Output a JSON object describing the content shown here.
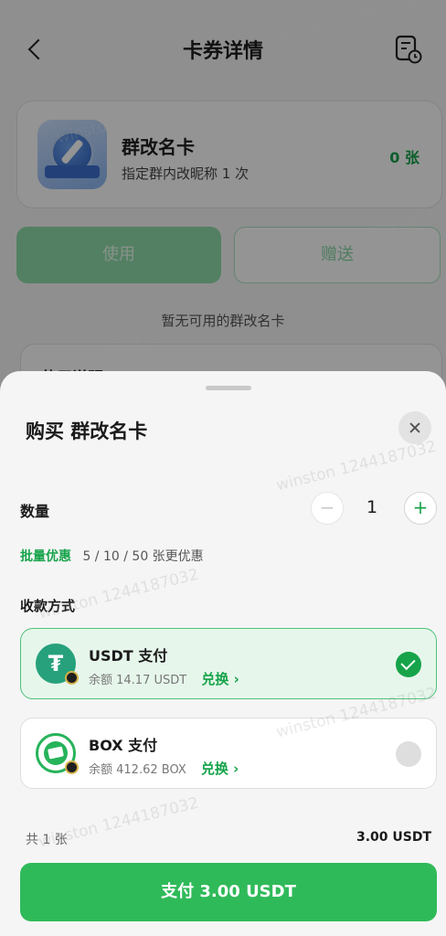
{
  "header": {
    "title": "卡券详情"
  },
  "card": {
    "name": "群改名卡",
    "description": "指定群内改昵称 1 次",
    "count": "0 张"
  },
  "actions": {
    "use_label": "使用",
    "gift_label": "赠送"
  },
  "empty_text": "暂无可用的群改名卡",
  "detail": {
    "title": "使用说明"
  },
  "sheet": {
    "title": "购买 群改名卡",
    "quantity_label": "数量",
    "quantity": "1",
    "minus": "−",
    "plus": "+",
    "bulk_label": "批量优惠",
    "bulk_text": "5 / 10 / 50 张更优惠",
    "payment_label": "收款方式",
    "methods": [
      {
        "name": "USDT 支付",
        "balance": "余额 14.17 USDT",
        "exchange": "兑换 ›",
        "selected": true,
        "icon": "tether-icon"
      },
      {
        "name": "BOX 支付",
        "balance": "余额 412.62 BOX",
        "exchange": "兑换 ›",
        "selected": false,
        "icon": "box-coin-icon"
      }
    ],
    "total_count": "共 1 张",
    "total_price": "3.00 USDT",
    "submit_label": "支付 3.00 USDT"
  },
  "watermark": "winston 1244187032",
  "colors": {
    "accent": "#16a34a",
    "button": "#2fba59"
  }
}
